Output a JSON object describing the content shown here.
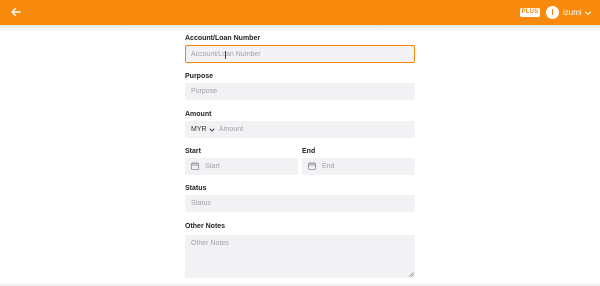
{
  "header": {
    "back_icon": "arrow-left-icon",
    "plan_badge": "PLUS",
    "user": {
      "avatar_letter": "I",
      "name": "izumi",
      "chevron_icon": "chevron-down-icon"
    },
    "accent_color": "#f7890d"
  },
  "form": {
    "account": {
      "label": "Account/Loan Number",
      "placeholder": "Account/Loan Number",
      "value": ""
    },
    "purpose": {
      "label": "Purpose",
      "placeholder": "Purpose",
      "value": ""
    },
    "amount": {
      "label": "Amount",
      "currency": "MYR",
      "placeholder": "Amount",
      "value": ""
    },
    "start": {
      "label": "Start",
      "placeholder": "Start",
      "icon": "calendar-icon"
    },
    "end": {
      "label": "End",
      "placeholder": "End",
      "icon": "calendar-icon"
    },
    "status": {
      "label": "Status",
      "placeholder": "Status",
      "value": ""
    },
    "notes": {
      "label": "Other Notes",
      "placeholder": "Other Notes",
      "value": ""
    }
  }
}
